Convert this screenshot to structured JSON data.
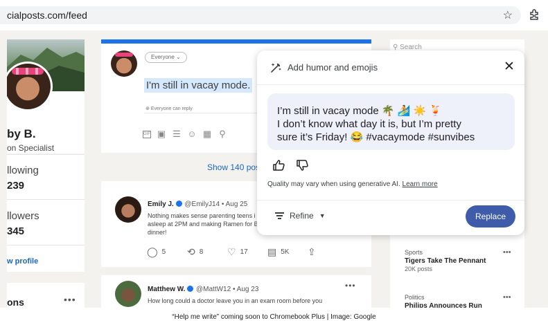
{
  "browser": {
    "url": "cialposts.com/feed",
    "star_icon": "star-icon",
    "extensions_icon": "extensions-icon"
  },
  "profile": {
    "name": "by B.",
    "title": "on Specialist",
    "following_label": "llowing",
    "following_count": "239",
    "followers_label": "llowers",
    "followers_count": "345",
    "view_profile": "w profile",
    "section_label": "ons",
    "section_more": "•••"
  },
  "composer": {
    "audience": "Everyone",
    "draft": "I'm still in vacay mode.",
    "reply_setting": "Everyone can reply",
    "gif_label": "GIF"
  },
  "feed": {
    "show_more": "Show 140 pos",
    "posts": [
      {
        "name": "Emily J.",
        "handle": "@EmilyJ14 • Aug 25",
        "body": "Nothing makes sense parenting teens i asleep at 2PM and making Ramen for B dinner!",
        "replies": "5",
        "reposts": "8",
        "likes": "17",
        "views": "5K"
      },
      {
        "name": "Matthew W.",
        "handle": "@MattW12 • Aug 23",
        "body": "How long could a doctor leave you in an exam room before you",
        "more": "•••"
      }
    ]
  },
  "rail": {
    "search_placeholder": "Search",
    "items": [
      {
        "category": "Sports",
        "title": "Tigers Take The Pennant",
        "meta": "20K posts"
      },
      {
        "category": "Politics",
        "title": "Philips Announces Run",
        "meta": ""
      }
    ],
    "more": "•••"
  },
  "popup": {
    "title": "Add humor and emojis",
    "suggestion_line1": "I’m still in vacay mode 🌴 🏄 ☀️ 🍹",
    "suggestion_line2": "I don’t know what day it is, but I’m pretty",
    "suggestion_line3": "sure it’s Friday! 😂 #vacaymode #sunvibes",
    "quality_note": "Quality may vary when using generative AI.",
    "learn_more": "Learn more",
    "refine_label": "Refine",
    "replace_label": "Replace",
    "accent": "#3e5ca9"
  },
  "caption": "“Help me write” coming soon to Chromebook Plus | Image: Google"
}
